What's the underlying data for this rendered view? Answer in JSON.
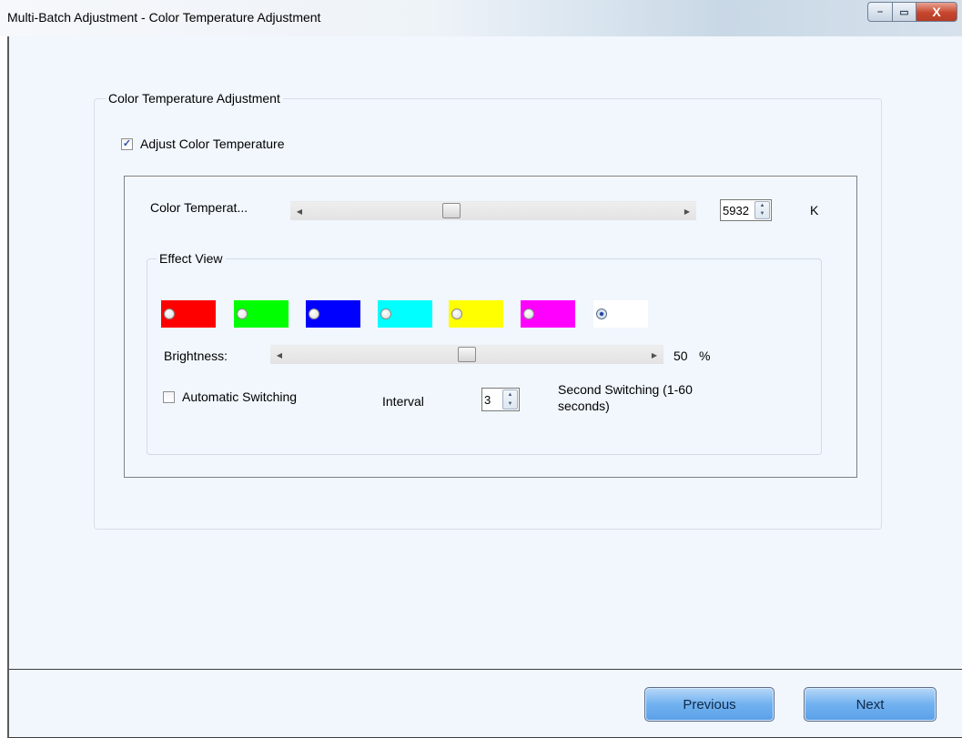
{
  "window": {
    "title": "Multi-Batch Adjustment - Color Temperature Adjustment",
    "buttons": {
      "minimize": "–",
      "maximize": "▭",
      "close": "X"
    }
  },
  "color_temp_group": {
    "legend": "Color Temperature Adjustment",
    "adjust_checkbox": {
      "label": "Adjust Color Temperature",
      "checked": true
    },
    "slider": {
      "label": "Color Temperat...",
      "value": 5932,
      "unit": "K",
      "position_fraction": 0.38
    },
    "spin_value": "5932"
  },
  "effect_view": {
    "legend": "Effect View",
    "swatches": [
      {
        "name": "red",
        "color": "#ff0000",
        "selected": false
      },
      {
        "name": "green",
        "color": "#00ff00",
        "selected": false
      },
      {
        "name": "blue",
        "color": "#0000ff",
        "selected": false
      },
      {
        "name": "cyan",
        "color": "#00ffff",
        "selected": false
      },
      {
        "name": "yellow",
        "color": "#ffff00",
        "selected": false
      },
      {
        "name": "magenta",
        "color": "#ff00ff",
        "selected": false
      },
      {
        "name": "white",
        "color": "#ffffff",
        "selected": true
      }
    ],
    "brightness": {
      "label": "Brightness:",
      "value": "50",
      "unit": "%",
      "position_fraction": 0.5
    },
    "auto_switch": {
      "label": "Automatic Switching",
      "checked": false
    },
    "interval": {
      "label": "Interval",
      "value": "3",
      "suffix_line1": "Second Switching (1-60",
      "suffix_line2": "seconds)"
    }
  },
  "footer": {
    "previous_label": "Previous",
    "next_label": "Next"
  }
}
